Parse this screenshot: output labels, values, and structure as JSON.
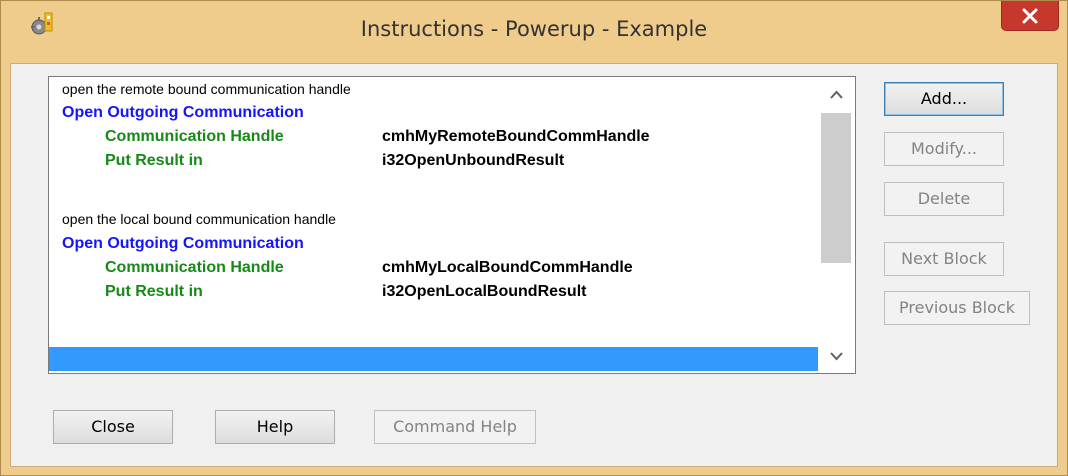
{
  "window": {
    "title": "Instructions - Powerup - Example",
    "close_glyph": "✕"
  },
  "icons": {
    "app": "app-icon",
    "close": "close-icon",
    "scroll_up": "chevron-up-icon",
    "scroll_down": "chevron-down-icon"
  },
  "instructions": {
    "blocks": [
      {
        "comment": "open the remote bound communication handle",
        "command": "Open Outgoing Communication",
        "params": [
          {
            "label": "Communication Handle",
            "value": "cmhMyRemoteBoundCommHandle"
          },
          {
            "label": "Put Result in",
            "value": "i32OpenUnboundResult"
          }
        ]
      },
      {
        "comment": "open the local bound communication handle",
        "command": "Open Outgoing Communication",
        "params": [
          {
            "label": "Communication Handle",
            "value": "cmhMyLocalBoundCommHandle"
          },
          {
            "label": "Put Result in",
            "value": "i32OpenLocalBoundResult"
          }
        ]
      }
    ]
  },
  "side_buttons": {
    "add": "Add...",
    "modify": "Modify...",
    "delete": "Delete",
    "next_block": "Next Block",
    "previous_block": "Previous Block"
  },
  "bottom_buttons": {
    "close": "Close",
    "help": "Help",
    "command_help": "Command Help"
  },
  "colors": {
    "frame": "#f0cc8c",
    "close_button": "#c7382c",
    "command_text": "#1414ff",
    "param_label_text": "#168a16",
    "selection": "#3399ff"
  }
}
